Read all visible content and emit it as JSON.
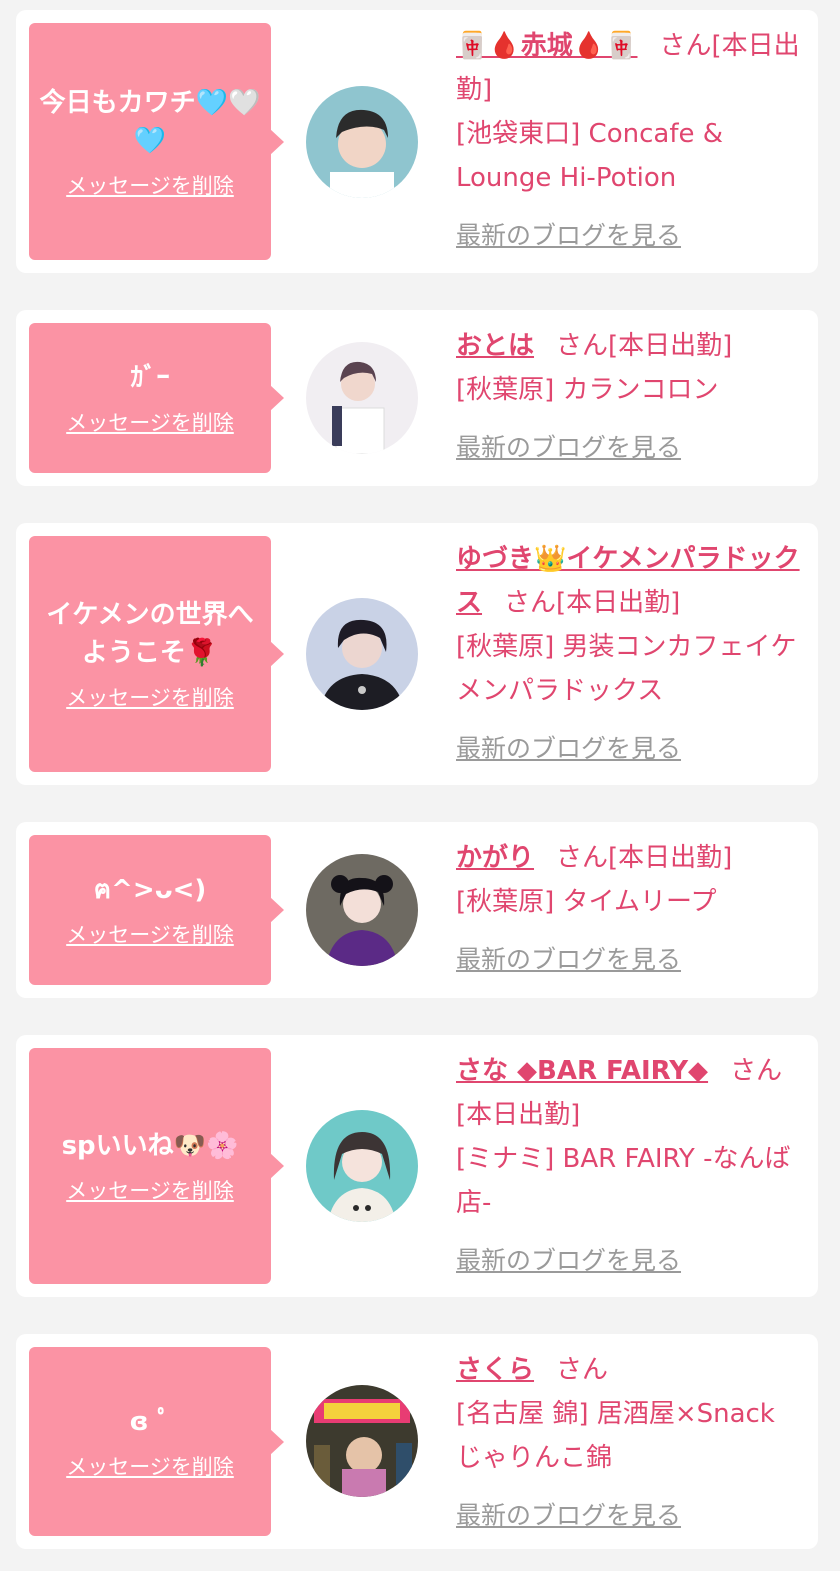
{
  "ui": {
    "delete_label": "メッセージを削除",
    "blog_label": "最新のブログを見る",
    "san_label": "さん",
    "accent_color": "#e0466f",
    "bubble_color": "#fb93a4"
  },
  "cards": [
    {
      "message": "今日もカワチ🩵🤍🩵",
      "name": "🀄🩸赤城🩸🀄",
      "status": "[本日出勤]",
      "shop": "[池袋東口] Concafe & Lounge Hi-Potion"
    },
    {
      "message": "ｶﾞｰ",
      "name": "おとは",
      "status": "[本日出勤]",
      "shop": "[秋葉原] カランコロン"
    },
    {
      "message": "イケメンの世界へようこそ🌹",
      "name": "ゆづき👑イケメンパラドックス",
      "status": "[本日出勤]",
      "shop": "[秋葉原] 男装コンカフェイケメンパラドックス"
    },
    {
      "message": "ฅ^>ᴗ<)",
      "name": "かがり",
      "status": "[本日出勤]",
      "shop": "[秋葉原] タイムリープ"
    },
    {
      "message": "spいいね🐶🌸",
      "name": "さな ◆BAR FAIRY◆",
      "status": "[本日出勤]",
      "shop": "[ミナミ] BAR FAIRY -なんば店-"
    },
    {
      "message": "ɞ ﾟ",
      "name": "さくら",
      "status": "",
      "shop": "[名古屋 錦] 居酒屋×Snack じゃりんこ錦"
    }
  ]
}
